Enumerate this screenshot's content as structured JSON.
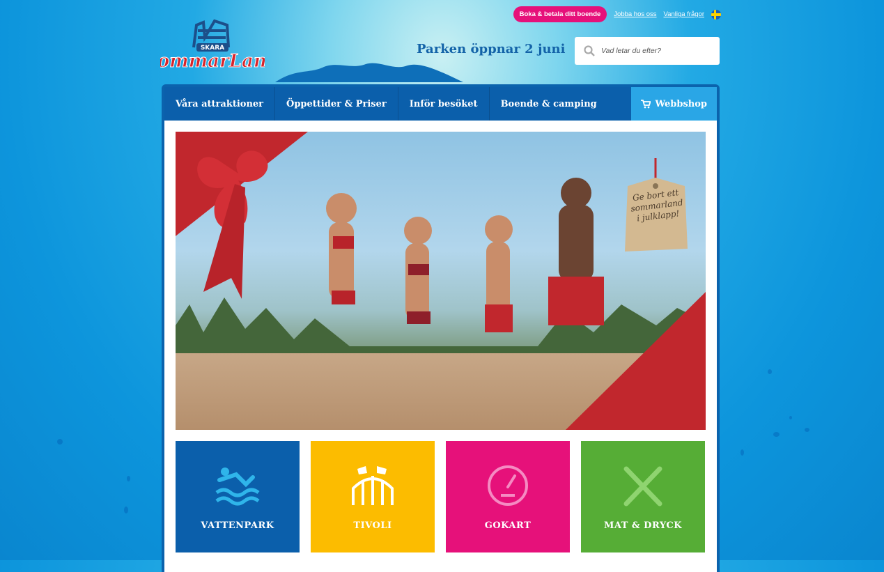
{
  "header": {
    "logo_text": "Skara Sommarland",
    "book_button": "Boka & betala ditt boende",
    "links": [
      "Jobba hos oss",
      "Vanliga frågor"
    ],
    "opening_text": "Parken öppnar 2 juni",
    "search_placeholder": "Vad letar du efter?"
  },
  "nav": {
    "items": [
      "Våra attraktioner",
      "Öppettider & Priser",
      "Inför besöket",
      "Boende & camping"
    ],
    "shop": "Webbshop"
  },
  "hero": {
    "tag_lines": [
      "Ge bort ett",
      "sommarland",
      "i julklapp!"
    ]
  },
  "tiles": [
    {
      "label": "VATTENPARK",
      "icon": "water-slide-icon",
      "color": "#0b5fab"
    },
    {
      "label": "TIVOLI",
      "icon": "roller-coaster-icon",
      "color": "#fcbc00"
    },
    {
      "label": "GOKART",
      "icon": "speedometer-icon",
      "color": "#e6117a"
    },
    {
      "label": "MAT & DRYCK",
      "icon": "fork-knife-icon",
      "color": "#56ad36"
    }
  ]
}
